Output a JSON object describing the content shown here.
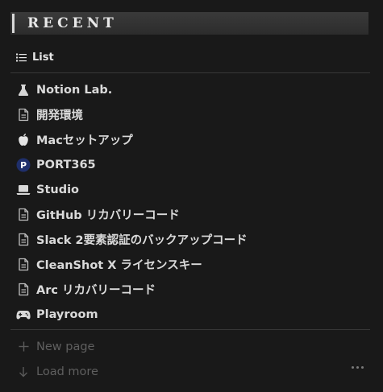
{
  "header": {
    "title": "RECENT"
  },
  "view": {
    "label": "List",
    "icon": "list-icon"
  },
  "items": [
    {
      "label": "Notion Lab.",
      "icon": "flask-icon"
    },
    {
      "label": "開発環境",
      "icon": "page-icon"
    },
    {
      "label": "Macセットアップ",
      "icon": "apple-icon"
    },
    {
      "label": "PORT365",
      "icon": "port365-logo-icon"
    },
    {
      "label": "Studio",
      "icon": "laptop-icon"
    },
    {
      "label": "GitHub リカバリーコード",
      "icon": "page-icon"
    },
    {
      "label": "Slack 2要素認証のバックアップコード",
      "icon": "page-icon"
    },
    {
      "label": "CleanShot X ライセンスキー",
      "icon": "page-icon"
    },
    {
      "label": "Arc リカバリーコード",
      "icon": "page-icon"
    },
    {
      "label": "Playroom",
      "icon": "gamepad-icon"
    }
  ],
  "footer": {
    "new_page": "New page",
    "load_more": "Load more"
  },
  "colors": {
    "background": "#191919",
    "text": "#dadada",
    "muted": "#5f5f5f",
    "port365_badge": "#1f2f6b"
  }
}
